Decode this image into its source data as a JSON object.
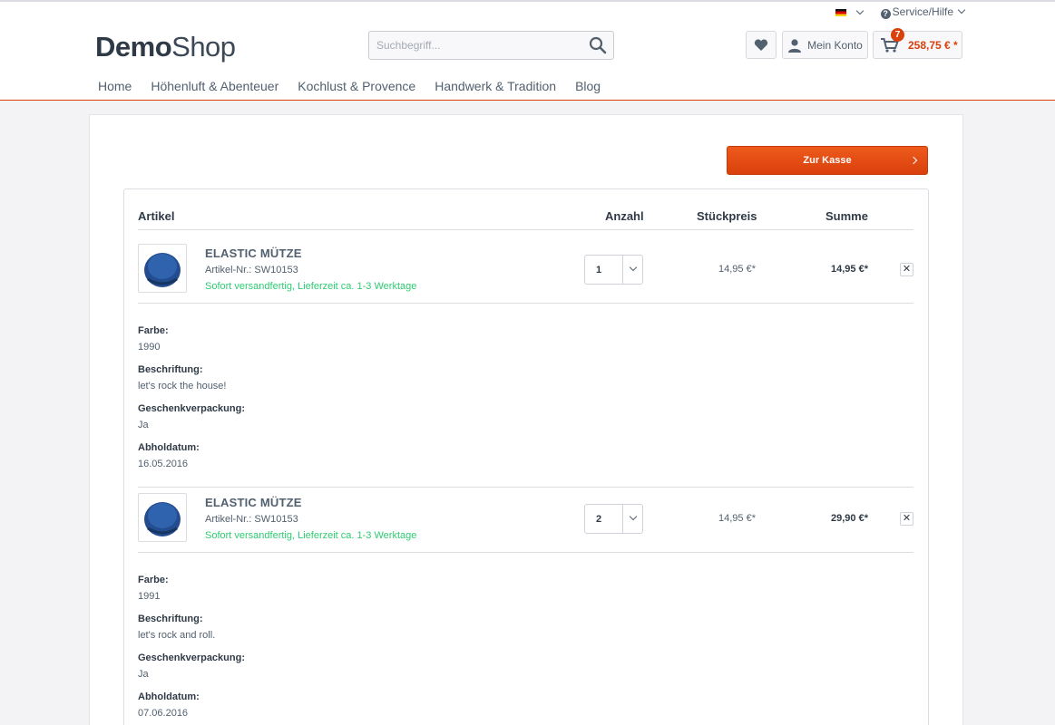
{
  "header": {
    "language": "",
    "service_label": "Service/Hilfe",
    "logo_bold": "Demo",
    "logo_light": "Shop",
    "search_placeholder": "Suchbegriff...",
    "account_label": "Mein Konto",
    "cart_count": "7",
    "cart_amount": "258,75 € *",
    "accent_color": "#d9400b"
  },
  "nav": [
    "Home",
    "Höhenluft & Abenteuer",
    "Kochlust & Provence",
    "Handwerk & Tradition",
    "Blog"
  ],
  "checkout_label": "Zur Kasse",
  "table": {
    "col_article": "Artikel",
    "col_qty": "Anzahl",
    "col_unit": "Stückpreis",
    "col_sum": "Summe"
  },
  "items": [
    {
      "name": "ELASTIC MÜTZE",
      "sku": "Artikel-Nr.: SW10153",
      "shipping": "Sofort versandfertig, Lieferzeit ca. 1-3 Werktage",
      "qty": "1",
      "unit_price": "14,95 €*",
      "total": "14,95 €*",
      "remove": "✕",
      "attributes": [
        {
          "label": "Farbe:",
          "value": "1990"
        },
        {
          "label": "Beschriftung:",
          "value": "let's rock the house!"
        },
        {
          "label": "Geschenkverpackung:",
          "value": "Ja"
        },
        {
          "label": "Abholdatum:",
          "value": "16.05.2016"
        }
      ]
    },
    {
      "name": "ELASTIC MÜTZE",
      "sku": "Artikel-Nr.: SW10153",
      "shipping": "Sofort versandfertig, Lieferzeit ca. 1-3 Werktage",
      "qty": "2",
      "unit_price": "14,95 €*",
      "total": "29,90 €*",
      "remove": "✕",
      "attributes": [
        {
          "label": "Farbe:",
          "value": "1991"
        },
        {
          "label": "Beschriftung:",
          "value": "let's rock and roll."
        },
        {
          "label": "Geschenkverpackung:",
          "value": "Ja"
        },
        {
          "label": "Abholdatum:",
          "value": "07.06.2016"
        }
      ]
    }
  ]
}
